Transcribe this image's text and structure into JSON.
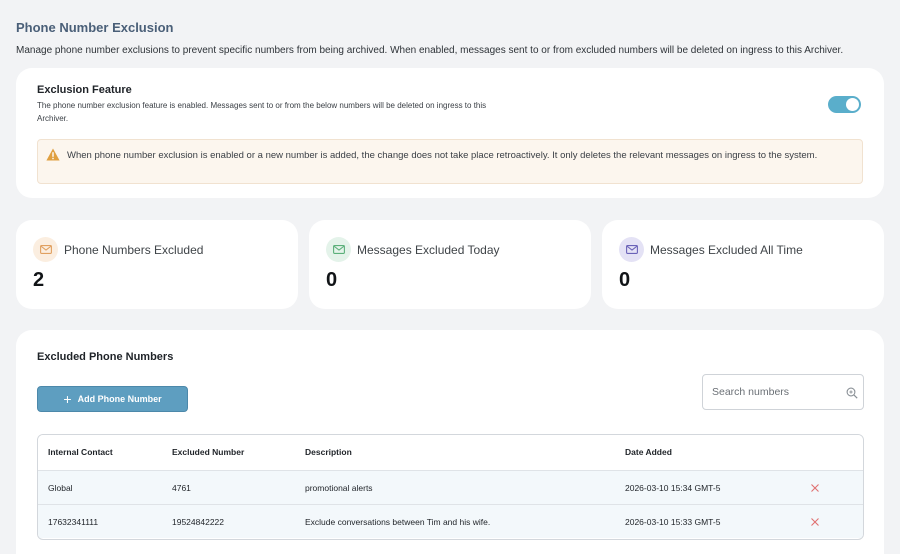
{
  "page": {
    "title": "Phone Number Exclusion",
    "description": "Manage phone number exclusions to prevent specific numbers from being archived. When enabled, messages sent to or from excluded numbers will be deleted on ingress to this Archiver."
  },
  "feature": {
    "title": "Exclusion Feature",
    "description": "The phone number exclusion feature is enabled. Messages sent to or from the below numbers will be deleted on ingress to this Archiver.",
    "enabled": true,
    "warning": "When phone number exclusion is enabled or a new number is added, the change does not take place retroactively. It only deletes the relevant messages on ingress to the system."
  },
  "stats": [
    {
      "label": "Phone Numbers Excluded",
      "value": "2",
      "icon": "envelope-icon",
      "icon_bg": "#fbeee0",
      "icon_color": "#e0a060"
    },
    {
      "label": "Messages Excluded Today",
      "value": "0",
      "icon": "envelope-icon",
      "icon_bg": "#e4f3ea",
      "icon_color": "#5bb07a"
    },
    {
      "label": "Messages Excluded All Time",
      "value": "0",
      "icon": "envelope-icon",
      "icon_bg": "#e4e2f5",
      "icon_color": "#6a62b8"
    }
  ],
  "list": {
    "title": "Excluded Phone Numbers",
    "add_button": "Add Phone Number",
    "search_placeholder": "Search numbers",
    "columns": [
      "Internal Contact",
      "Excluded Number",
      "Description",
      "Date Added"
    ],
    "rows": [
      [
        "Global",
        "4761",
        "promotional alerts",
        "2026-03-10 15:34 GMT-5"
      ],
      [
        "17632341111",
        "19524842222",
        "Exclude conversations between Tim and his wife.",
        "2026-03-10 15:33 GMT-5"
      ]
    ]
  },
  "colors": {
    "accent": "#5aaecb",
    "button": "#5e9ec0",
    "warning": "#e0a040",
    "delete": "#e07070"
  }
}
